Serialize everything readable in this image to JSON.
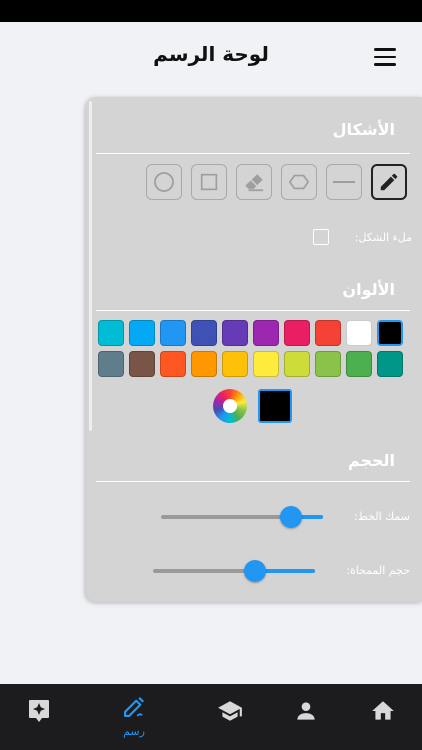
{
  "header": {
    "title": "لوحة الرسم",
    "menu_icon": "hamburger-menu-icon"
  },
  "sections": {
    "shapes_title": "الأشكال",
    "colors_title": "الألوان",
    "size_title": "الحجم"
  },
  "tools": [
    {
      "name": "pencil",
      "icon": "pencil-icon",
      "active": true
    },
    {
      "name": "line",
      "icon": "line-icon",
      "active": false
    },
    {
      "name": "hexagon",
      "icon": "hexagon-icon",
      "active": false
    },
    {
      "name": "eraser",
      "icon": "eraser-icon",
      "active": false
    },
    {
      "name": "square",
      "icon": "square-icon",
      "active": false
    },
    {
      "name": "circle",
      "icon": "circle-icon",
      "active": false
    }
  ],
  "fill_shape": {
    "label": "ملء الشكل:",
    "checked": false
  },
  "palette": {
    "row1": [
      "#000000",
      "#ffffff",
      "#f44336",
      "#e91e63",
      "#9c27b0",
      "#673ab7",
      "#3f51b5",
      "#2196f3",
      "#03a9f4",
      "#00bcd4"
    ],
    "row2": [
      "#009688",
      "#4caf50",
      "#8bc34a",
      "#cddc39",
      "#ffeb3b",
      "#ffc107",
      "#ff9800",
      "#ff5722",
      "#795548",
      "#607d8b"
    ],
    "selected": "#000000",
    "current_color": "#000000",
    "picker_icon": "color-wheel-icon"
  },
  "sliders": {
    "stroke": {
      "label": "سمك الخط:",
      "value_percent": 20
    },
    "eraser": {
      "label": "حجم الممحاة:",
      "value_percent": 37
    }
  },
  "tabs": [
    {
      "name": "home",
      "icon": "home-icon",
      "active": false
    },
    {
      "name": "profile",
      "icon": "person-icon",
      "active": false
    },
    {
      "name": "learn",
      "icon": "graduation-cap-icon",
      "active": false
    },
    {
      "name": "draw",
      "icon": "draw-icon",
      "label": "رسم",
      "active": true
    },
    {
      "name": "sparkle",
      "icon": "sparkle-badge-icon",
      "active": false
    }
  ],
  "colors": {
    "accent": "#2196f3",
    "panel": "#d4d4d4",
    "tabbar": "#1c1c1e",
    "inactive_tab": "#d8d8d8"
  }
}
